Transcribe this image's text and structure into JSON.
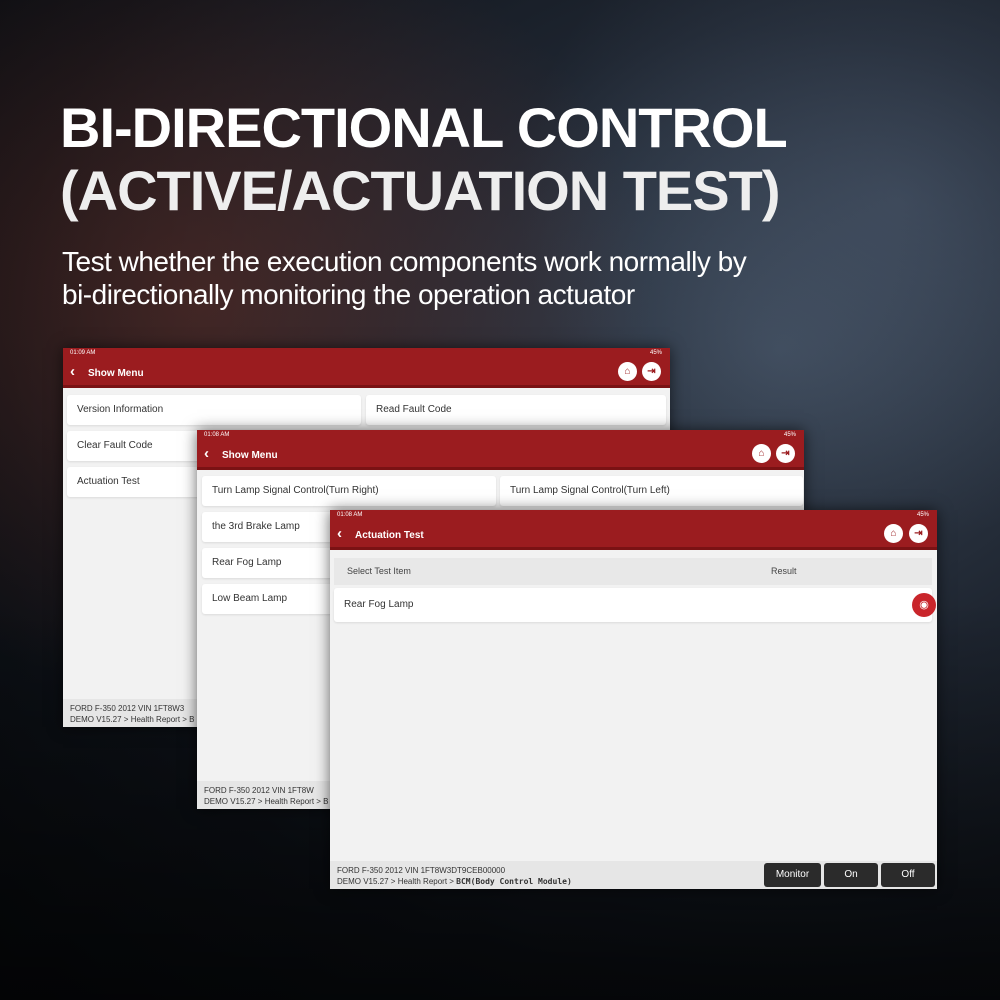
{
  "headline": {
    "line1": "BI-DIRECTIONAL CONTROL",
    "line2": "(ACTIVE/ACTUATION TEST)",
    "subtitle_line1": "Test whether the execution components work normally by",
    "subtitle_line2": "bi-directionally monitoring the operation actuator"
  },
  "colors": {
    "header_red": "#9b1c1f"
  },
  "screen1": {
    "time": "01:09 AM",
    "battery": "45%",
    "title": "Show Menu",
    "items": [
      "Version Information",
      "Read Fault Code",
      "Clear Fault Code",
      "Actuation Test"
    ],
    "footer_line1": "FORD  F-350  2012  VIN  1FT8W3",
    "footer_line2": "DEMO V15.27 > Health Report >  B"
  },
  "screen2": {
    "time": "01:08 AM",
    "battery": "45%",
    "title": "Show Menu",
    "items": [
      "Turn Lamp Signal Control(Turn Right)",
      "Turn Lamp Signal Control(Turn Left)",
      "the 3rd Brake Lamp",
      "Rear Fog Lamp",
      "Low Beam Lamp"
    ],
    "footer_line1": "FORD  F-350  2012  VIN  1FT8W",
    "footer_line2": "DEMO V15.27 > Health Report >  B"
  },
  "screen3": {
    "time": "01:08 AM",
    "battery": "45%",
    "title": "Actuation Test",
    "col_item": "Select Test Item",
    "col_result": "Result",
    "row_item": "Rear Fog Lamp",
    "footer_line1": "FORD  F-350  2012  VIN  1FT8W3DT9CEB00000",
    "footer_path": "DEMO V15.27 > Health Report > ",
    "footer_module": "BCM(Body Control Module)",
    "buttons": [
      "Monitor",
      "On",
      "Off"
    ]
  }
}
